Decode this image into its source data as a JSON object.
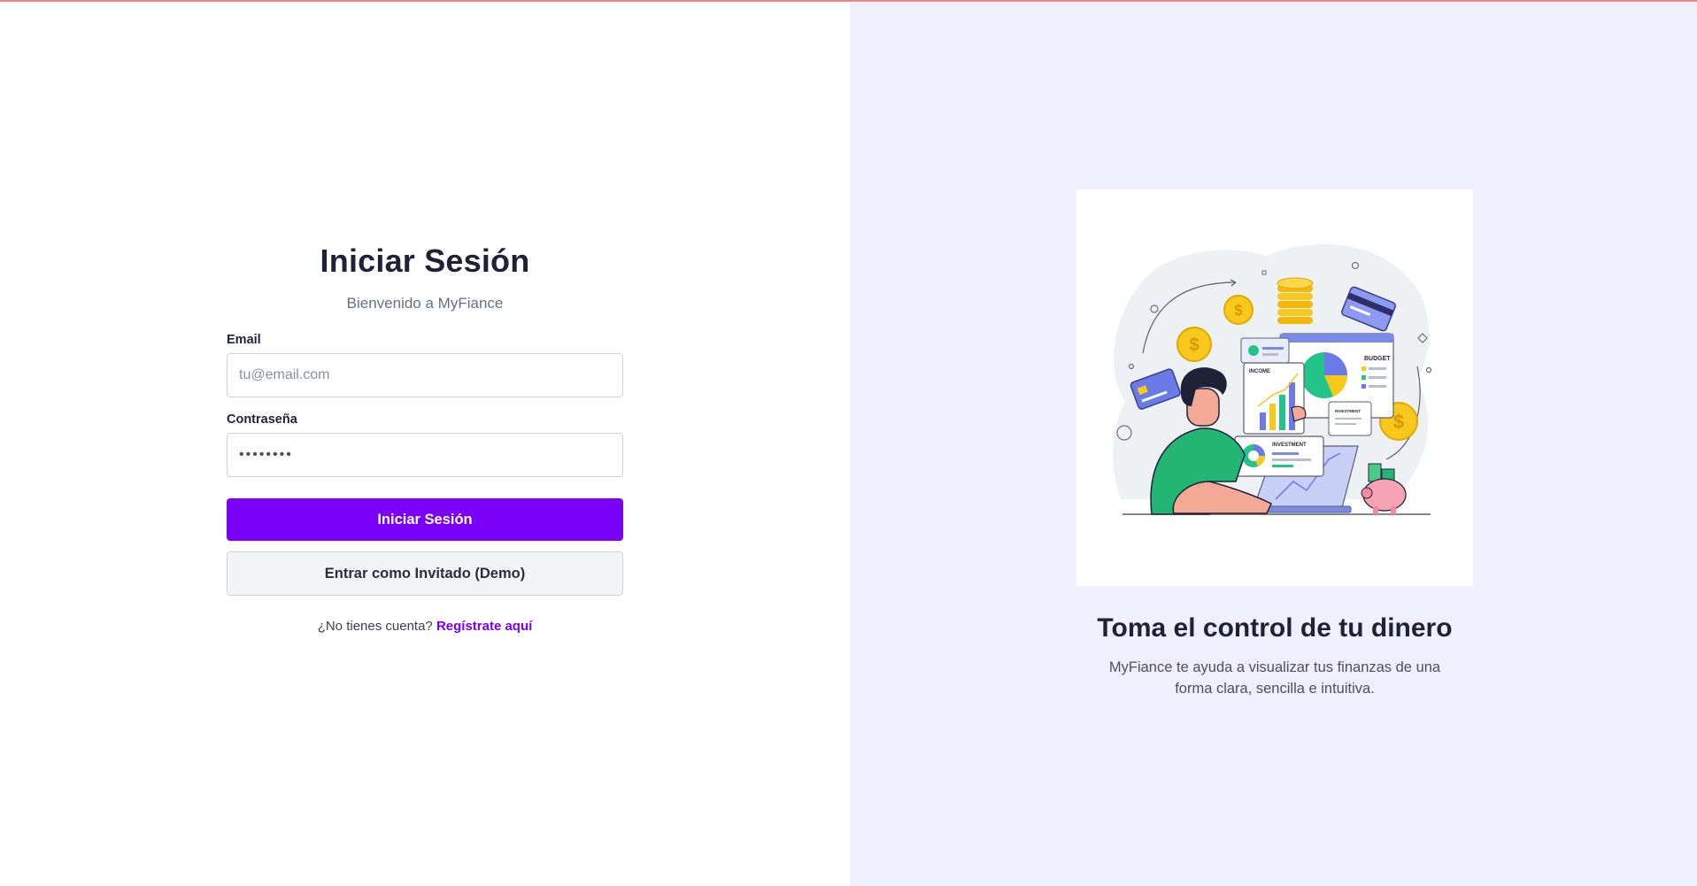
{
  "login": {
    "title": "Iniciar Sesión",
    "subtitle": "Bienvenido a MyFiance",
    "email_label": "Email",
    "email_placeholder": "tu@email.com",
    "password_label": "Contraseña",
    "password_value": "••••••••",
    "submit_label": "Iniciar Sesión",
    "guest_label": "Entrar como Invitado (Demo)",
    "signup_prompt": "¿No tienes cuenta?",
    "signup_link": "Regístrate aquí"
  },
  "promo": {
    "heading": "Toma el control de tu dinero",
    "description": "MyFiance te ayuda a visualizar tus finanzas de una forma clara, sencilla e intuitiva.",
    "illustration_labels": {
      "income": "INCOME",
      "budget": "BUDGET",
      "investment": "INVESTMENT",
      "investment_small": "INVESTMENT"
    }
  },
  "colors": {
    "accent": "#7b00f7",
    "right_panel_bg": "#efeffd",
    "heading_text": "#1f2237"
  }
}
